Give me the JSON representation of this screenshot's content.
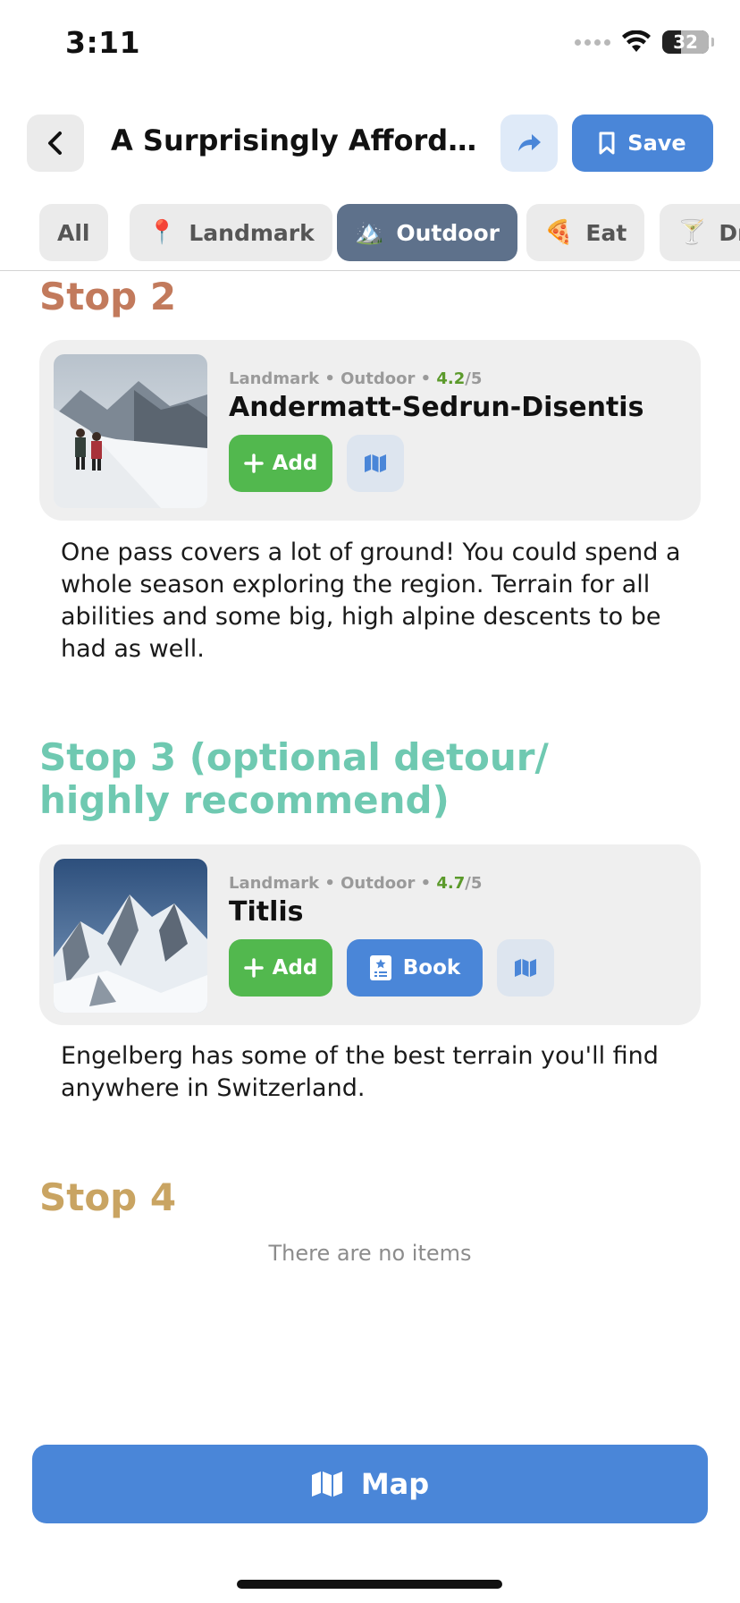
{
  "status_bar": {
    "time": "3:11",
    "battery": "32"
  },
  "header": {
    "title": "A Surprisingly Affordabl...",
    "save_label": "Save"
  },
  "filters": [
    {
      "label": "All",
      "icon": "",
      "active": false
    },
    {
      "label": "Landmark",
      "icon": "📍",
      "active": false
    },
    {
      "label": "Outdoor",
      "icon": "🏔️",
      "active": true
    },
    {
      "label": "Eat",
      "icon": "🍕",
      "active": false
    },
    {
      "label": "Dr",
      "icon": "🍸",
      "active": false
    }
  ],
  "stops": [
    {
      "title": "Stop 2",
      "title_line2": "",
      "color": "#c27a5c",
      "places": [
        {
          "name": "Andermatt-Sedrun-Disentis",
          "categories": "Landmark • Outdoor •",
          "rating": "4.2",
          "rating_suffix": "/5",
          "add_label": "Add",
          "book_label": "",
          "description": "One pass covers a lot of ground! You could spend a whole season exploring the region. Terrain for all abilities and some big, high alpine descents to be had as well."
        }
      ]
    },
    {
      "title": "Stop 3 (optional detour/",
      "title_line2": "highly recommend)",
      "color": "#6fc9b1",
      "places": [
        {
          "name": "Titlis",
          "categories": "Landmark • Outdoor •",
          "rating": "4.7",
          "rating_suffix": "/5",
          "add_label": "Add",
          "book_label": "Book",
          "description": "Engelberg has some of the best terrain you'll find anywhere in Switzerland."
        }
      ]
    },
    {
      "title": "Stop 4",
      "title_line2": "",
      "color": "#c9a462",
      "empty_text": "There are no items"
    }
  ],
  "map_button_label": "Map"
}
